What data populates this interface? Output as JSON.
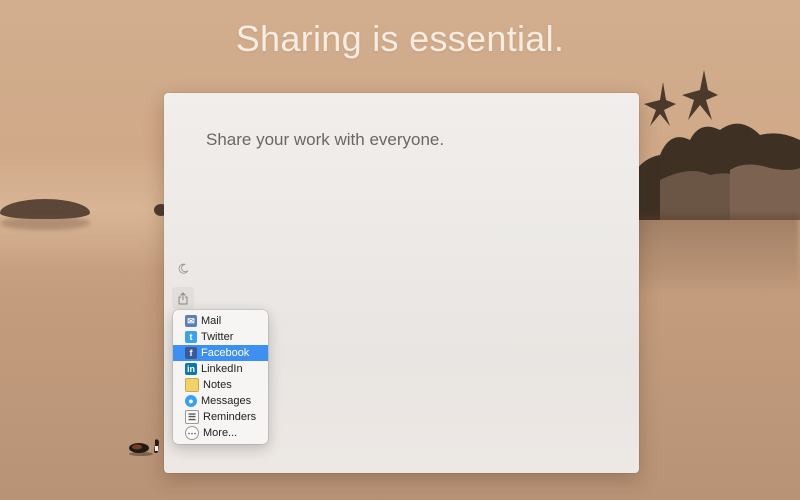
{
  "headline": "Sharing is essential.",
  "document": {
    "text": "Share your work with everyone."
  },
  "toolbar": {
    "theme_icon": "moon-icon",
    "share_icon": "share-icon"
  },
  "share_menu": {
    "selected": "Facebook",
    "items": [
      {
        "label": "Mail",
        "icon": "mail-icon",
        "color": "#5b7fb6"
      },
      {
        "label": "Twitter",
        "icon": "twitter-icon",
        "color": "#3aa3e8"
      },
      {
        "label": "Facebook",
        "icon": "facebook-icon",
        "color": "#3b5998"
      },
      {
        "label": "LinkedIn",
        "icon": "linkedin-icon",
        "color": "#0e76a8"
      },
      {
        "label": "Notes",
        "icon": "notes-icon",
        "color": "#f2d16b"
      },
      {
        "label": "Messages",
        "icon": "messages-icon",
        "color": "#3aa0f0"
      },
      {
        "label": "Reminders",
        "icon": "reminders-icon",
        "color": "#e0e0e0"
      },
      {
        "label": "More...",
        "icon": "more-icon",
        "color": "#c8c8c8"
      }
    ]
  },
  "colors": {
    "selection": "#3d8ff0",
    "background": "#cfa887"
  }
}
